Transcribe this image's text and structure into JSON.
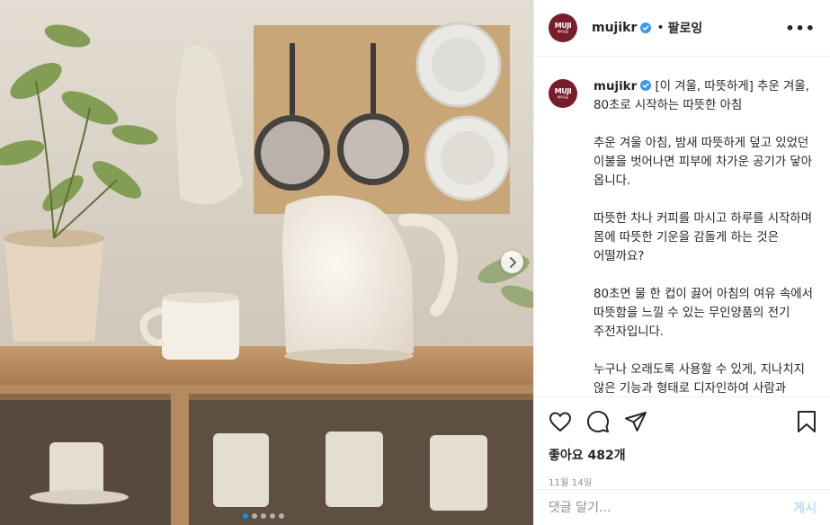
{
  "account": {
    "username": "mujikr",
    "avatar_line1": "MUJI",
    "avatar_line2": "無印良品",
    "follow_label": "팔로잉",
    "separator": "•"
  },
  "caption": {
    "text": " [이 겨울, 따뜻하게] 추운 겨울, 80초로 시작하는 따뜻한 아침\n\n추운 겨울 아침, 밤새 따뜻하게 덮고 있었던 이불을 벗어나면 피부에 차가운 공기가 닿아 옵니다.\n\n따뜻한 차나 커피를 마시고 하루를 시작하며 몸에 따뜻한 기운을 감돌게 하는 것은 어떨까요?\n\n80초면 물 한 컵이 끓어 아침의 여유 속에서 따뜻함을 느낄 수 있는 무인양품의 전기 주전자입니다.\n\n누구나 오래도록 사용할 수 있게, 지나치지 않은 기능과 형태로 디자인하여 사람과 주방을 둘러싼 환경에 조화를 이룹니다.\n\n항상 사람 주변에서 주방 식기와 함께 머무르며, 부드러운 곡선 모양으로 제작되어 마치 몸"
  },
  "stats": {
    "likes": "좋아요 482개",
    "date": "11월 14일"
  },
  "comment": {
    "placeholder": "댓글 달기...",
    "post_label": "게시"
  },
  "carousel": {
    "total": 5,
    "active": 0
  },
  "colors": {
    "verified": "#3897f0",
    "avatar_bg": "#7a1d2a",
    "active_dot": "#0095f6",
    "post_disabled": "#b2dffc"
  },
  "icons": [
    "verified-badge-icon",
    "more-options-icon",
    "heart-icon",
    "comment-icon",
    "share-icon",
    "bookmark-icon",
    "chevron-right-icon"
  ]
}
